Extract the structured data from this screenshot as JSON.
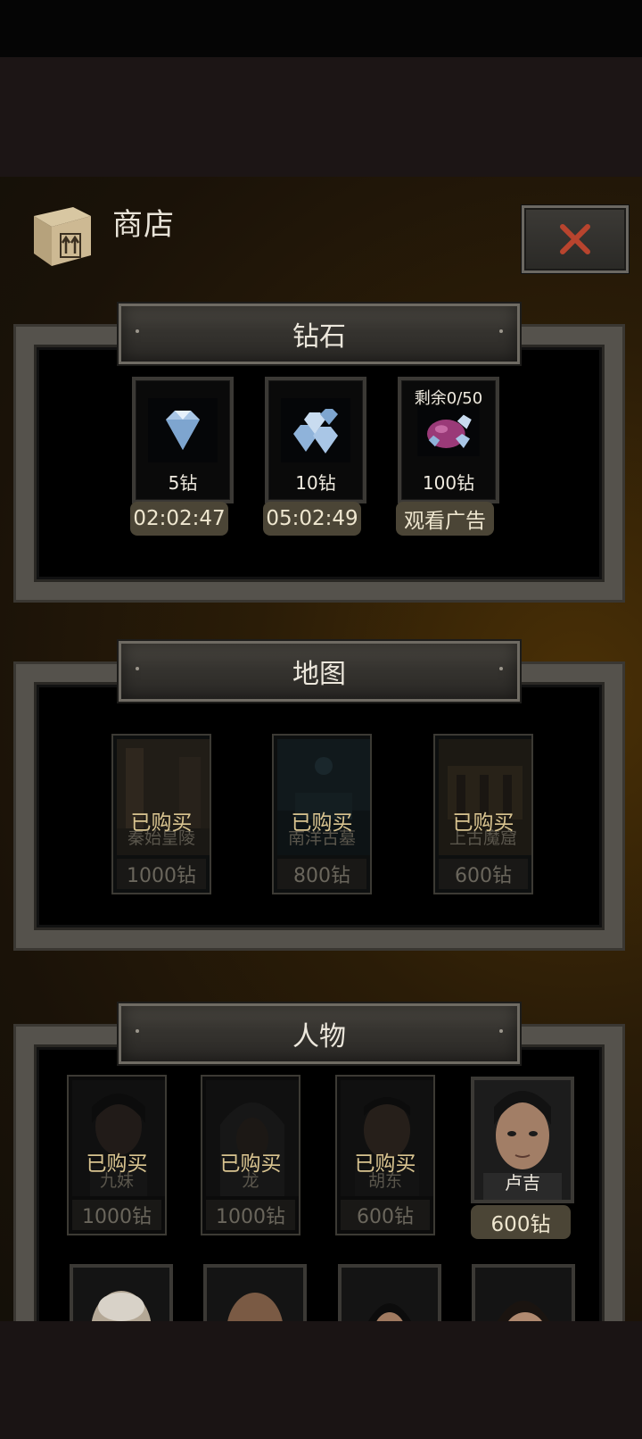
{
  "header": {
    "title": "商店"
  },
  "sections": {
    "diamond": {
      "title": "钻石",
      "items": [
        {
          "caption": "5钻",
          "button": "02:02:47"
        },
        {
          "caption": "10钻",
          "button": "05:02:49"
        },
        {
          "note": "剩余0/50",
          "caption": "100钻",
          "button": "观看广告"
        }
      ]
    },
    "map": {
      "title": "地图",
      "items": [
        {
          "status": "已购买",
          "name": "秦始皇陵",
          "price": "1000钻"
        },
        {
          "status": "已购买",
          "name": "南洋古墓",
          "price": "800钻"
        },
        {
          "status": "已购买",
          "name": "上古魔窟",
          "price": "600钻"
        }
      ]
    },
    "character": {
      "title": "人物",
      "items": [
        {
          "status": "已购买",
          "name": "九妹",
          "price": "1000钻"
        },
        {
          "status": "已购买",
          "name": "龙",
          "price": "1000钻"
        },
        {
          "status": "已购买",
          "name": "胡东",
          "price": "600钻"
        },
        {
          "name": "卢吉",
          "price": "600钻"
        }
      ]
    }
  },
  "colors": {
    "accent_text": "#d9c490",
    "close_x": "#b8442e",
    "panel_bg": "#2a1c07"
  }
}
